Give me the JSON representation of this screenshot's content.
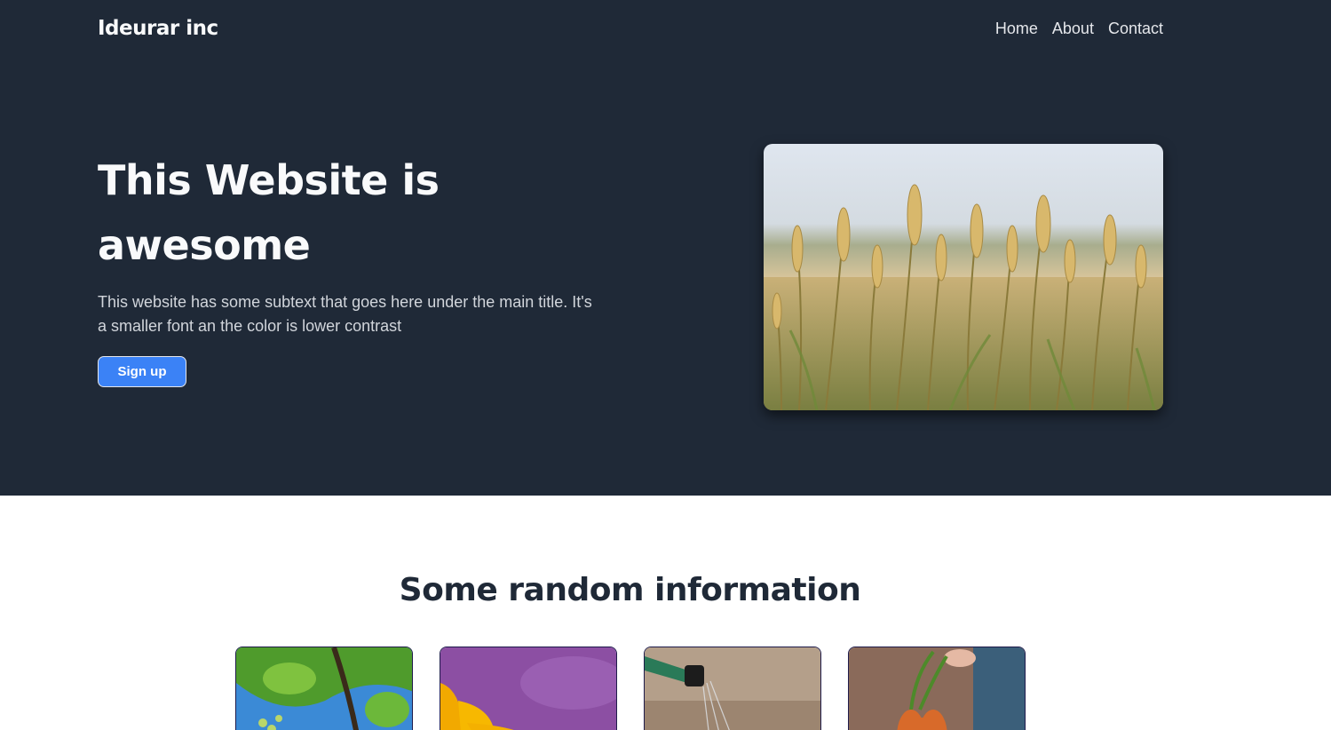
{
  "header": {
    "brand": "Ideurar inc",
    "nav": [
      {
        "label": "Home"
      },
      {
        "label": "About"
      },
      {
        "label": "Contact"
      }
    ]
  },
  "hero": {
    "title": "This Website is awesome",
    "subtext": "This website has some subtext that goes here under the main title. It's a smaller font an the color is lower contrast",
    "cta_label": "Sign up",
    "image": "wheat-field-photo"
  },
  "info": {
    "title": "Some random information",
    "cards": [
      {
        "image": "grapevine-photo"
      },
      {
        "image": "sunflower-photo"
      },
      {
        "image": "watering-can-photo"
      },
      {
        "image": "carrots-photo"
      }
    ]
  },
  "colors": {
    "hero_bg": "#1f2937",
    "accent": "#3b82f6",
    "heading_dark": "#1f2937",
    "text_light": "#f9fafb",
    "text_muted": "#d1d5db"
  }
}
